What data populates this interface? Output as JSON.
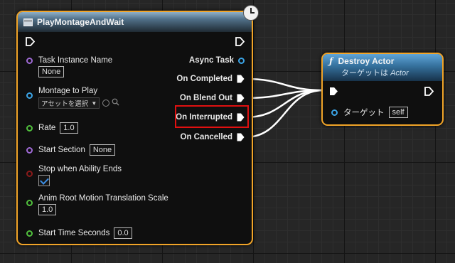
{
  "colors": {
    "node_border": "#f1a428",
    "exec_pin": "#ffffff",
    "object_pin": "#3ba4e6",
    "string_pin": "#9f6ad6",
    "float_pin": "#51c13d",
    "bool_pin": "#8b1a1a",
    "highlight": "#e01010",
    "function_header": "#35709c"
  },
  "node_montage": {
    "title": "PlayMontageAndWait",
    "title_icon": "function-node-icon",
    "badge_icon": "latent-clock-icon",
    "inputs": {
      "task_instance_name": {
        "label": "Task Instance Name",
        "value": "None"
      },
      "montage_to_play": {
        "label": "Montage to Play",
        "dropdown": "アセットを選択",
        "browse_icon": "browse-arrow-icon",
        "search_icon": "search-icon"
      },
      "rate": {
        "label": "Rate",
        "value": "1.0"
      },
      "start_section": {
        "label": "Start Section",
        "value": "None"
      },
      "stop_when_ability_ends": {
        "label": "Stop when Ability Ends",
        "checked": true
      },
      "anim_root_motion": {
        "label": "Anim Root Motion Translation Scale",
        "value": "1.0"
      },
      "start_time_seconds": {
        "label": "Start Time Seconds",
        "value": "0.0"
      }
    },
    "outputs": {
      "async_task": "Async Task",
      "on_completed": "On Completed",
      "on_blend_out": "On Blend Out",
      "on_interrupted": "On Interrupted",
      "on_cancelled": "On Cancelled"
    }
  },
  "node_destroy": {
    "title": "Destroy Actor",
    "title_icon": "function-f-icon",
    "subtitle_prefix": "ターゲットは ",
    "subtitle_target": "Actor",
    "target_label": "ターゲット",
    "target_value": "self"
  }
}
